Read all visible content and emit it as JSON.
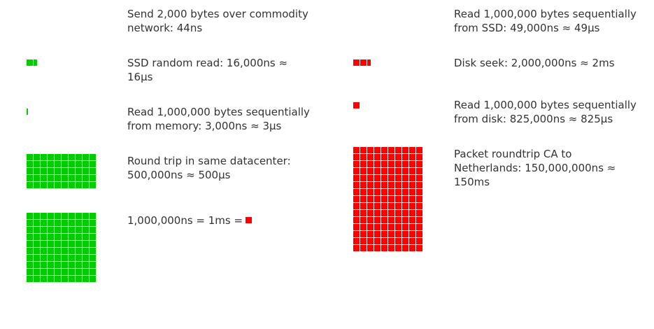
{
  "colors": {
    "green": "#00cc00",
    "red": "#ff0000"
  },
  "left": [
    {
      "text": "Send 2,000 bytes over commodity network: 44ns",
      "units": 0,
      "color": "green"
    },
    {
      "text": "SSD random read: 16,000ns ≈ 16μs",
      "units": 2,
      "color": "green"
    },
    {
      "text": "Read 1,000,000 bytes sequentially from memory: 3,000ns ≈ 3μs",
      "units": 0.3,
      "color": "green"
    },
    {
      "text": "Round trip in same datacenter: 500,000ns ≈ 500μs",
      "units": 50,
      "color": "green"
    },
    {
      "text": "1,000,000ns = 1ms =",
      "units": 100,
      "color": "green"
    }
  ],
  "right": [
    {
      "text": "Read 1,000,000 bytes sequentially from SSD: 49,000ns ≈ 49μs",
      "units": 0,
      "color": "red"
    },
    {
      "text": "Disk seek: 2,000,000ns ≈ 2ms",
      "units": 2,
      "color": "red"
    },
    {
      "text": "Read 1,000,000 bytes sequentially from disk: 825,000ns ≈ 825μs",
      "units": 1,
      "color": "red"
    },
    {
      "text": "Packet roundtrip CA to Netherlands: 150,000,000ns ≈ 150ms",
      "units": 150,
      "color": "red"
    }
  ]
}
